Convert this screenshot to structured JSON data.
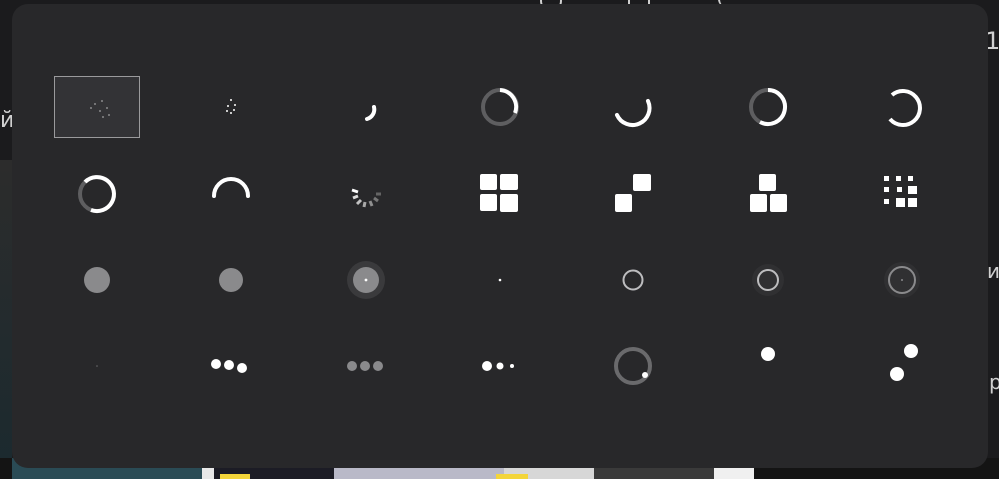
{
  "background": {
    "chars": [
      "1",
      "и",
      "р",
      "й"
    ]
  },
  "modal": {
    "selected_index": 0,
    "colors": {
      "surface": "#28282a",
      "foreground": "#ffffff",
      "muted": "#8a8a8c",
      "selected_border": "#9a9a9c"
    },
    "spinners": [
      {
        "icon": "dotted-sparkle-spinner-icon"
      },
      {
        "icon": "small-dots-spinner-icon"
      },
      {
        "icon": "arc-small-spinner-icon"
      },
      {
        "icon": "ring-partial-bright-spinner-icon"
      },
      {
        "icon": "arc-bottom-spinner-icon"
      },
      {
        "icon": "ring-partial-spinner-icon"
      },
      {
        "icon": "ring-open-spinner-icon"
      },
      {
        "icon": "ring-thick-spinner-icon"
      },
      {
        "icon": "arc-top-spinner-icon"
      },
      {
        "icon": "segmented-line-spinner-icon"
      },
      {
        "icon": "grid-squares-spinner-icon"
      },
      {
        "icon": "two-squares-spinner-icon"
      },
      {
        "icon": "three-squares-spinner-icon"
      },
      {
        "icon": "pixel-grid-spinner-icon"
      },
      {
        "icon": "gray-dot-spinner-icon"
      },
      {
        "icon": "gray-dot-2-spinner-icon"
      },
      {
        "icon": "pulse-halo-dot-spinner-icon"
      },
      {
        "icon": "tiny-dot-spinner-icon"
      },
      {
        "icon": "hollow-circle-spinner-icon"
      },
      {
        "icon": "hollow-circle-halo-spinner-icon"
      },
      {
        "icon": "target-circle-spinner-icon"
      },
      {
        "icon": "faint-dot-spinner-icon"
      },
      {
        "icon": "three-dots-bounce-spinner-icon"
      },
      {
        "icon": "three-dots-gray-spinner-icon"
      },
      {
        "icon": "dots-shrinking-spinner-icon"
      },
      {
        "icon": "orbit-ring-spinner-icon"
      },
      {
        "icon": "single-dot-spinner-icon"
      },
      {
        "icon": "two-dots-orbit-spinner-icon"
      }
    ]
  }
}
